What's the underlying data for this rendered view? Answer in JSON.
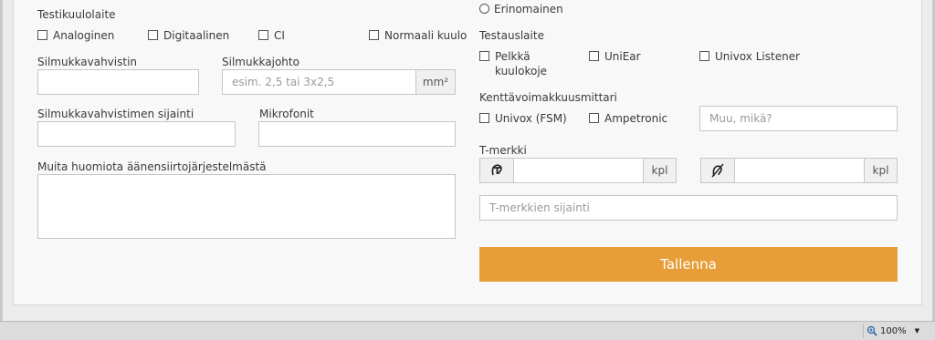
{
  "left": {
    "testikuulolaite": {
      "label": "Testikuulolaite",
      "options": [
        "Analoginen",
        "Digitaalinen",
        "CI",
        "Normaali kuulo"
      ]
    },
    "silmukkavahvistin": {
      "label": "Silmukkavahvistin",
      "value": ""
    },
    "silmukkajohto": {
      "label": "Silmukkajohto",
      "placeholder": "esim. 2,5 tai 3x2,5",
      "unit": "mm²"
    },
    "sijainti": {
      "label": "Silmukkavahvistimen sijainti",
      "value": ""
    },
    "mikrofonit": {
      "label": "Mikrofonit",
      "value": ""
    },
    "huomioita": {
      "label": "Muita huomiota äänensiirtojärjestelmästä",
      "value": ""
    }
  },
  "right": {
    "rating_option": "Erinomainen",
    "testauslaite": {
      "label": "Testauslaite",
      "options": [
        "Pelkkä kuulokoje",
        "UniEar",
        "Univox Listener"
      ]
    },
    "kenttavoimakkuusmittari": {
      "label": "Kenttävoimakkuusmittari",
      "options": [
        "Univox (FSM)",
        "Ampetronic"
      ],
      "other_placeholder": "Muu, mikä?"
    },
    "t_merkki": {
      "label": "T-merkki",
      "unit": "kpl"
    },
    "t_merkkien_sijainti": {
      "placeholder": "T-merkkien sijainti"
    },
    "save_label": "Tallenna"
  },
  "statusbar": {
    "zoom": "100%"
  },
  "colors": {
    "accent": "#e89e38",
    "panel": "#f8f8f8"
  },
  "icons": [
    "t-loop-ear-icon",
    "hearing-loop-ear-icon",
    "magnifier-icon",
    "dropdown-arrow-icon"
  ]
}
